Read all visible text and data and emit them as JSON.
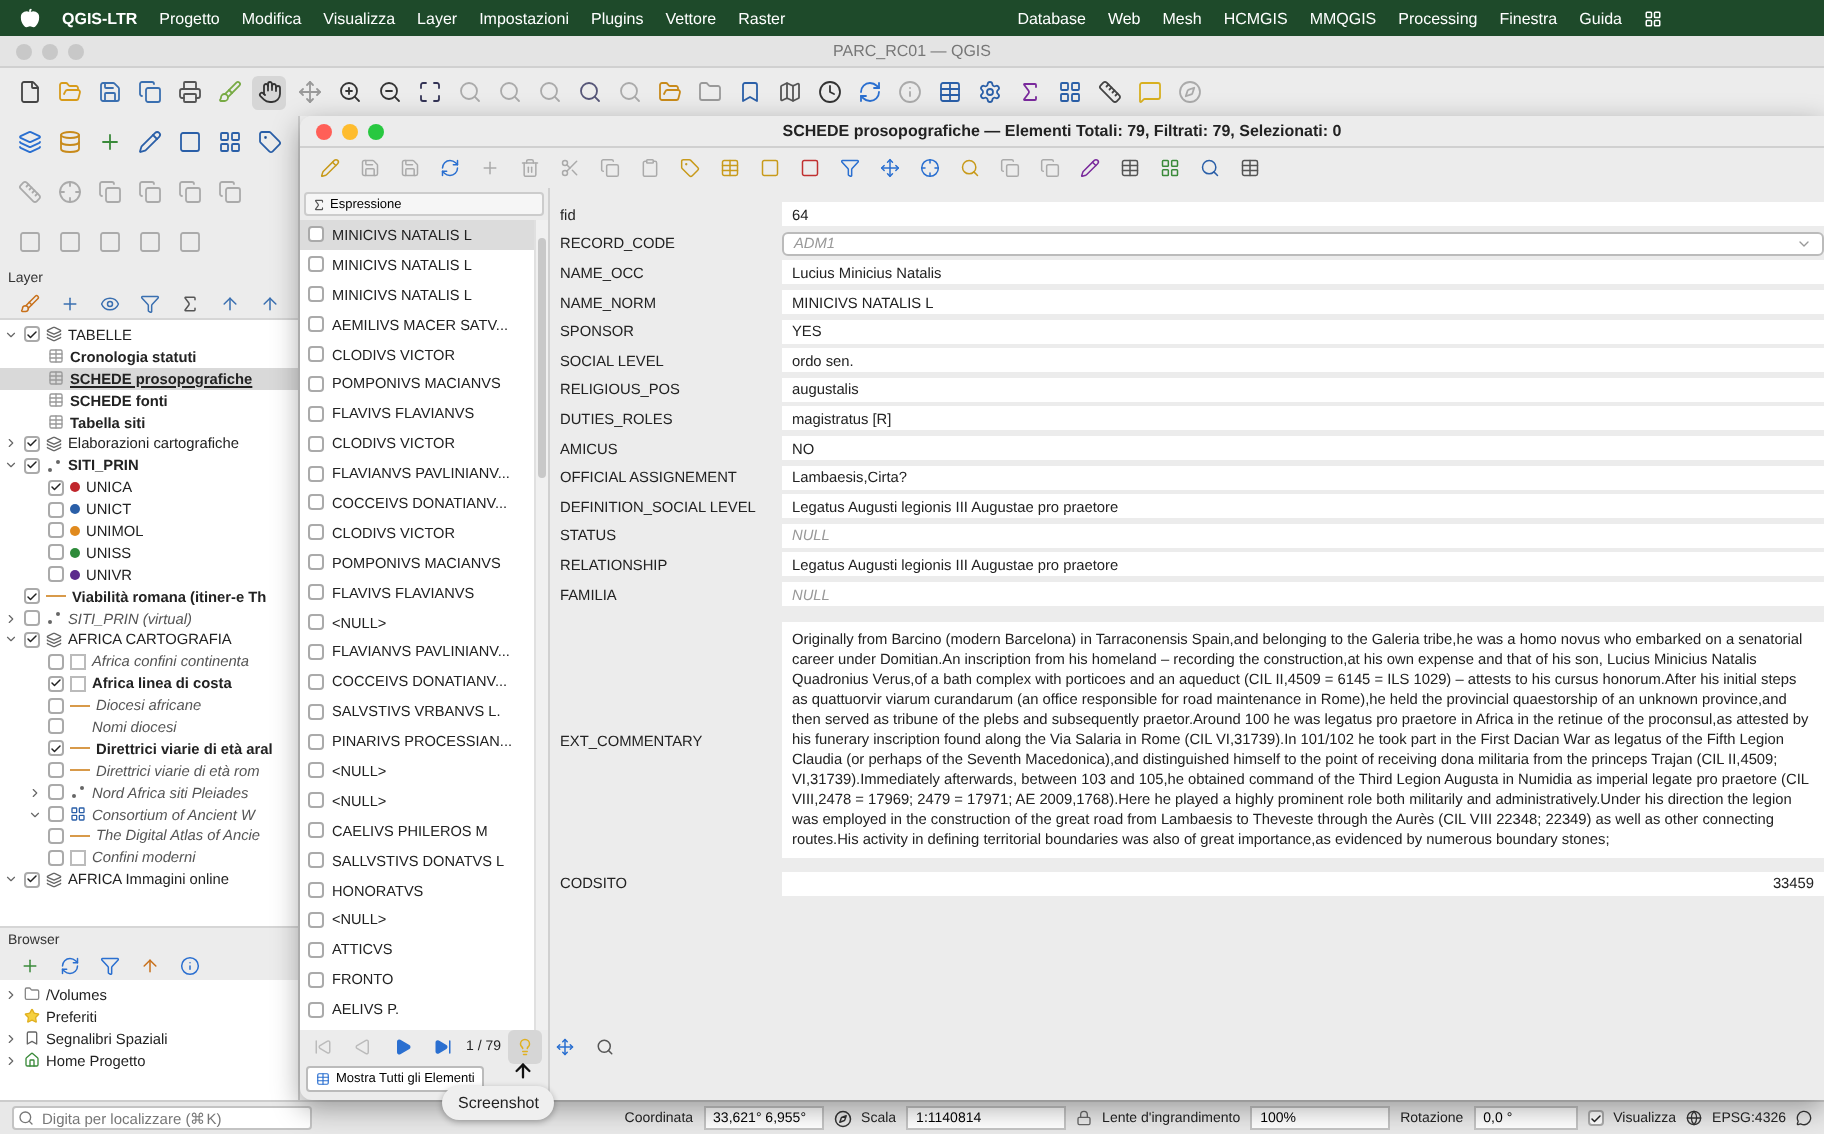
{
  "menubar": {
    "app": "QGIS-LTR",
    "menus": [
      "Progetto",
      "Modifica",
      "Visualizza",
      "Layer",
      "Impostazioni",
      "Plugins",
      "Vettore",
      "Raster"
    ],
    "right_menus": [
      "Database",
      "Web",
      "Mesh",
      "HCMGIS",
      "MMQGIS",
      "Processing",
      "Finestra",
      "Guida"
    ]
  },
  "window": {
    "title": "PARC_RC01 — QGIS"
  },
  "layers_panel": {
    "title": "Layer",
    "tree": [
      {
        "label": "TABELLE",
        "kind": "group",
        "bold": false,
        "italic": false,
        "checked": true,
        "expanded": true,
        "selected": false,
        "children": [
          {
            "label": "Cronologia statuti",
            "kind": "table",
            "bold": true,
            "italic": false,
            "selected": false
          },
          {
            "label": "SCHEDE prosopografiche",
            "kind": "table",
            "bold": true,
            "italic": false,
            "selected": true
          },
          {
            "label": "SCHEDE fonti",
            "kind": "table",
            "bold": true,
            "italic": false,
            "selected": false
          },
          {
            "label": "Tabella siti",
            "kind": "table",
            "bold": true,
            "italic": false,
            "selected": false
          }
        ]
      },
      {
        "label": "Elaborazioni cartografiche",
        "kind": "group",
        "bold": false,
        "italic": false,
        "checked": true,
        "expanded": false,
        "selected": false
      },
      {
        "label": "SITI_PRIN",
        "kind": "point",
        "bold": true,
        "italic": false,
        "checked": true,
        "expanded": true,
        "selected": false,
        "children": [
          {
            "label": "UNICA",
            "kind": "category",
            "bold": false,
            "italic": false,
            "checked": true,
            "color": "#c0262c",
            "selected": false
          },
          {
            "label": "UNICT",
            "kind": "category",
            "bold": false,
            "italic": false,
            "checked": false,
            "color": "#2a5fa8",
            "selected": false
          },
          {
            "label": "UNIMOL",
            "kind": "category",
            "bold": false,
            "italic": false,
            "checked": false,
            "color": "#e08a1e",
            "selected": false
          },
          {
            "label": "UNISS",
            "kind": "category",
            "bold": false,
            "italic": false,
            "checked": false,
            "color": "#2e8b3a",
            "selected": false
          },
          {
            "label": "UNIVR",
            "kind": "category",
            "bold": false,
            "italic": false,
            "checked": false,
            "color": "#5b2a8c",
            "selected": false
          }
        ]
      },
      {
        "label": "Viabilità romana (itiner-e Th",
        "kind": "line",
        "bold": true,
        "italic": false,
        "checked": true,
        "selected": false
      },
      {
        "label": "SITI_PRIN (virtual)",
        "kind": "point",
        "bold": false,
        "italic": true,
        "checked": false,
        "expanded": false,
        "selected": false
      },
      {
        "label": "AFRICA CARTOGRAFIA",
        "kind": "group",
        "bold": false,
        "italic": false,
        "checked": true,
        "expanded": true,
        "selected": false,
        "children": [
          {
            "label": "Africa confini continenta",
            "kind": "polygon",
            "bold": false,
            "italic": true,
            "checked": false,
            "selected": false
          },
          {
            "label": "Africa linea di costa",
            "kind": "polygon",
            "bold": true,
            "italic": false,
            "checked": true,
            "selected": false
          },
          {
            "label": "Diocesi africane",
            "kind": "line",
            "bold": false,
            "italic": true,
            "checked": false,
            "selected": false
          },
          {
            "label": "Nomi diocesi",
            "kind": "none",
            "bold": false,
            "italic": true,
            "checked": false,
            "selected": false
          },
          {
            "label": "Direttrici viarie di età aral",
            "kind": "line",
            "bold": true,
            "italic": false,
            "checked": true,
            "selected": false
          },
          {
            "label": "Direttrici viarie di età rom",
            "kind": "line",
            "bold": false,
            "italic": true,
            "checked": false,
            "selected": false
          },
          {
            "label": "Nord Africa siti Pleiades",
            "kind": "point",
            "bold": false,
            "italic": true,
            "checked": false,
            "expanded": false,
            "selected": false
          },
          {
            "label": "Consortium of Ancient W",
            "kind": "raster",
            "bold": false,
            "italic": true,
            "checked": false,
            "expanded": true,
            "selected": false
          },
          {
            "label": "The Digital Atlas of Ancie",
            "kind": "line",
            "bold": false,
            "italic": true,
            "checked": false,
            "selected": false
          },
          {
            "label": "Confini moderni",
            "kind": "polygon",
            "bold": false,
            "italic": true,
            "checked": false,
            "selected": false
          }
        ]
      },
      {
        "label": "AFRICA Immagini online",
        "kind": "group",
        "bold": false,
        "italic": false,
        "checked": true,
        "expanded": true,
        "selected": false
      }
    ]
  },
  "browser": {
    "title": "Browser",
    "items": [
      {
        "label": "/Volumes",
        "kind": "folder",
        "expanded": false
      },
      {
        "label": "Preferiti",
        "kind": "favorites"
      },
      {
        "label": "Segnalibri Spaziali",
        "kind": "bookmarks",
        "expanded": false
      },
      {
        "label": "Home Progetto",
        "kind": "home",
        "expanded": false
      }
    ]
  },
  "locator": {
    "placeholder": "Digita per localizzare (⌘K)"
  },
  "status_bar": {
    "coordinate_label": "Coordinata",
    "coordinate": "33,621° 6,955°",
    "scale_label": "Scala",
    "scale": "1:1140814",
    "magnifier_label": "Lente d'ingrandimento",
    "magnifier": "100%",
    "rotation_label": "Rotazione",
    "rotation": "0,0 °",
    "render_label": "Visualizza",
    "render_checked": true,
    "crs": "EPSG:4326"
  },
  "tooltip": "Screenshot",
  "form_window": {
    "title": "SCHEDE prosopografiche — Elementi Totali: 79, Filtrati: 79, Selezionati: 0",
    "expression": "Espressione",
    "records": [
      {
        "label": "MINICIVS NATALIS L",
        "selected": true,
        "checked": false
      },
      {
        "label": "MINICIVS NATALIS L",
        "selected": false,
        "checked": false
      },
      {
        "label": "MINICIVS NATALIS L",
        "selected": false,
        "checked": false
      },
      {
        "label": "AEMILIVS MACER SATV...",
        "selected": false,
        "checked": false
      },
      {
        "label": "CLODIVS VICTOR",
        "selected": false,
        "checked": false
      },
      {
        "label": "POMPONIVS MACIANVS",
        "selected": false,
        "checked": false
      },
      {
        "label": "FLAVIVS FLAVIANVS",
        "selected": false,
        "checked": false
      },
      {
        "label": "CLODIVS VICTOR",
        "selected": false,
        "checked": false
      },
      {
        "label": "FLAVIANVS PAVLINIANV...",
        "selected": false,
        "checked": false
      },
      {
        "label": "COCCEIVS DONATIANV...",
        "selected": false,
        "checked": false
      },
      {
        "label": "CLODIVS VICTOR",
        "selected": false,
        "checked": false
      },
      {
        "label": "POMPONIVS MACIANVS",
        "selected": false,
        "checked": false
      },
      {
        "label": "FLAVIVS FLAVIANVS",
        "selected": false,
        "checked": false
      },
      {
        "label": "<NULL>",
        "selected": false,
        "checked": false
      },
      {
        "label": "FLAVIANVS PAVLINIANV...",
        "selected": false,
        "checked": false
      },
      {
        "label": "COCCEIVS DONATIANV...",
        "selected": false,
        "checked": false
      },
      {
        "label": "SALVSTIVS VRBANVS L.",
        "selected": false,
        "checked": false
      },
      {
        "label": "PINARIVS PROCESSIAN...",
        "selected": false,
        "checked": false
      },
      {
        "label": "<NULL>",
        "selected": false,
        "checked": false
      },
      {
        "label": "<NULL>",
        "selected": false,
        "checked": false
      },
      {
        "label": "CAELIVS PHILEROS M",
        "selected": false,
        "checked": false
      },
      {
        "label": "SALLVSTIVS DONATVS L",
        "selected": false,
        "checked": false
      },
      {
        "label": "HONORATVS",
        "selected": false,
        "checked": false
      },
      {
        "label": "<NULL>",
        "selected": false,
        "checked": false
      },
      {
        "label": "ATTICVS",
        "selected": false,
        "checked": false
      },
      {
        "label": "FRONTO",
        "selected": false,
        "checked": false
      },
      {
        "label": "AELIVS P.",
        "selected": false,
        "checked": false
      }
    ],
    "counter": "1 / 79",
    "show_all": "Mostra Tutti gli Elementi",
    "fields": [
      {
        "label": "fid",
        "kind": "text",
        "value": "64"
      },
      {
        "label": "RECORD_CODE",
        "kind": "combo",
        "value": "ADM1"
      },
      {
        "label": "NAME_OCC",
        "kind": "text",
        "value": "Lucius Minicius Natalis"
      },
      {
        "label": "NAME_NORM",
        "kind": "text",
        "value": "MINICIVS NATALIS L"
      },
      {
        "label": "SPONSOR",
        "kind": "text",
        "value": "YES"
      },
      {
        "label": "SOCIAL LEVEL",
        "kind": "text",
        "value": "ordo sen."
      },
      {
        "label": "RELIGIOUS_POS",
        "kind": "text",
        "value": "augustalis"
      },
      {
        "label": "DUTIES_ROLES",
        "kind": "text",
        "value": "magistratus [R]"
      },
      {
        "label": "AMICUS",
        "kind": "text",
        "value": "NO"
      },
      {
        "label": "OFFICIAL ASSIGNEMENT",
        "kind": "text",
        "value": "Lambaesis,Cirta?"
      },
      {
        "label": "DEFINITION_SOCIAL LEVEL",
        "kind": "text",
        "value": "Legatus Augusti legionis III  Augustae pro praetore"
      },
      {
        "label": "STATUS",
        "kind": "null",
        "value": "NULL"
      },
      {
        "label": "RELATIONSHIP",
        "kind": "text",
        "value": "Legatus Augusti legionis III  Augustae pro praetore"
      },
      {
        "label": "FAMILIA",
        "kind": "null",
        "value": "NULL"
      },
      {
        "label": "EXT_COMMENTARY",
        "kind": "multiline",
        "value": "Originally from Barcino (modern Barcelona) in Tarraconensis Spain,and belonging to the Galeria tribe,he was a homo novus who embarked on a senatorial career under Domitian.An inscription from his homeland – recording the construction,at his own expense and that of his son, Lucius Minicius Natalis Quadronius Verus,of a bath complex with porticoes and an aqueduct (CIL II,4509 = 6145 = ILS 1029) – attests to his cursus honorum.After his initial steps as quattuorvir viarum curandarum (an office responsible for road maintenance in Rome),he held the provincial quaestorship of an unknown province,and then served as tribune of the plebs and subsequently praetor.Around 100 he was legatus pro praetore in Africa in the retinue of the proconsul,as attested by his funerary inscription found along the Via Salaria in Rome (CIL VI,31739).In 101/102 he took part in the First Dacian War as legatus of the Fifth Legion Claudia (or perhaps of the Seventh Macedonica),and distinguished himself to the point of receiving dona militaria from the princeps Trajan (CIL II,4509; VI,31739).Immediately afterwards, between 103 and 105,he obtained command of the Third Legion Augusta in Numidia as imperial legate pro praetore (CIL VIII,2478 = 17969; 2479 = 17971; AE 2009,1768).Here he played a highly prominent role both militarily and administratively.Under his direction the legion was employed in the construction of the great road from Lambaesis to Theveste through the Aurès (CIL VIII 22348; 22349) as well as other connecting routes.His activity in defining territorial boundaries was also of great importance,as evidenced by numerous boundary stones;"
      },
      {
        "label": "CODSITO",
        "kind": "number",
        "value": "33459"
      }
    ]
  }
}
